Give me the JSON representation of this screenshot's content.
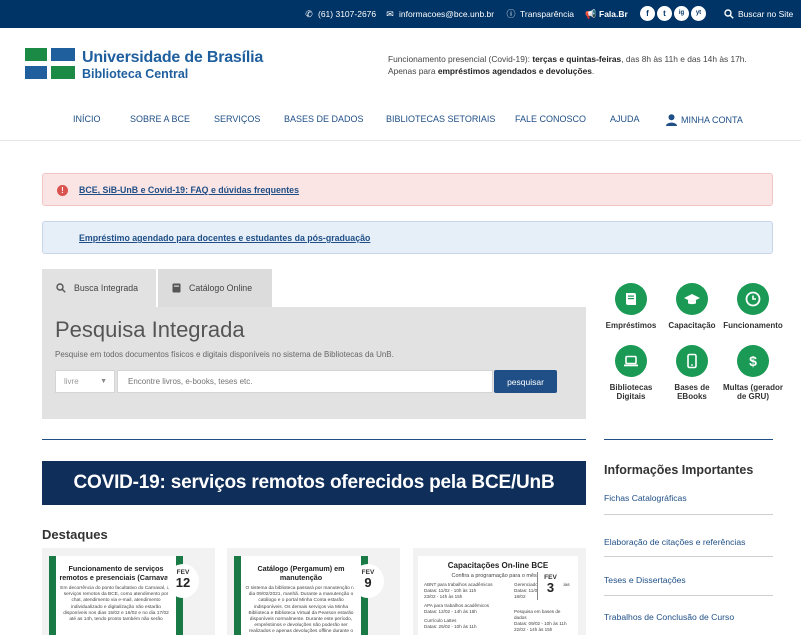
{
  "topbar": {
    "phone": "(61) 3107-2676",
    "email": "informacoes@bce.unb.br",
    "transparency": "Transparência",
    "fala": "Fala.Br",
    "social": [
      "f",
      "t",
      "ig",
      "yt"
    ],
    "search_label": "Buscar no Site"
  },
  "header": {
    "title": "Universidade de Brasília",
    "subtitle": "Biblioteca Central",
    "notice_line1_a": "Funcionamento presencial (Covid-19): ",
    "notice_line1_b": "terças e quintas-feiras",
    "notice_line1_c": ", das 8h às 11h e das 14h às 17h.",
    "notice_line2_a": "Apenas para ",
    "notice_line2_b": "empréstimos agendados e devoluções",
    "notice_line2_c": "."
  },
  "nav": {
    "items": [
      "INÍCIO",
      "SOBRE A BCE",
      "SERVIÇOS",
      "BASES DE DADOS",
      "BIBLIOTECAS SETORIAIS",
      "FALE CONOSCO",
      "AJUDA"
    ],
    "account": "MINHA CONTA"
  },
  "alerts": {
    "covid": "BCE, SiB-UnB e Covid-19: FAQ e dúvidas frequentes",
    "loan": "Empréstimo agendado para docentes e estudantes da pós-graduação"
  },
  "search": {
    "tabs": [
      "Busca Integrada",
      "Catálogo Online"
    ],
    "title": "Pesquisa Integrada",
    "subtitle": "Pesquise em todos documentos físicos e digitais disponíveis no sistema de Bibliotecas da UnB.",
    "select_value": "livre",
    "placeholder": "Encontre livros, e-books, teses etc.",
    "button": "pesquisar"
  },
  "quick_links": [
    {
      "label": "Empréstimos",
      "icon": "book-icon"
    },
    {
      "label": "Capacitação",
      "icon": "graduation-cap-icon"
    },
    {
      "label": "Funcionamento",
      "icon": "clock-icon"
    },
    {
      "label": "Bibliotecas Digitais",
      "icon": "laptop-icon"
    },
    {
      "label": "Bases de EBooks",
      "icon": "tablet-icon"
    },
    {
      "label": "Multas (gerador de GRU)",
      "icon": "dollar-icon"
    }
  ],
  "banner": "COVID-19: serviços remotos oferecidos pela BCE/UnB",
  "destaques": {
    "title": "Destaques",
    "cards": [
      {
        "title": "Funcionamento de serviços remotos e presenciais (Carnaval)",
        "body": "Em decorrência do ponto facultativo do Carnaval, os serviços remotos da BCE, como atendimento por chat, atendimento via e-mail, atendimento individualizado e digitalização não estarão disponíveis nos dias 15/02 e 16/02 e no dia 17/02 até as 14h, tendo pronto também não serão",
        "month": "FEV",
        "day": "12"
      },
      {
        "title": "Catálogo (Pergamum) em manutenção",
        "body": "O sistema da biblioteca passará por manutenção no dia 09/02/2021, manhã. Durante a manutenção o catálogo e o portal Minha Conta estarão indisponíveis. Os demais serviços via Minha Biblioteca e Biblioteca Virtual da Pearson estarão disponíveis normalmente. Durante este período, empréstimos e devoluções não poderão ser realizados e apenas devoluções offline durante o funcionamento.",
        "month": "FEV",
        "day": "9"
      },
      {
        "title": "Capacitações On-line BCE",
        "subtitle": "Confira a programação para o mês de",
        "month": "FEV",
        "day": "3",
        "lines": [
          "ABNT para trabalhos acadêmicos",
          "Datas: 11/02 - 10h às 11h",
          "23/02 - 14h às 15h",
          "APA para trabalhos acadêmicos",
          "Datas: 12/02 - 14h às 15h",
          "Currículo Lattes",
          "Datas: 25/02 - 10h às 11h"
        ],
        "lines_right": [
          "Gerenciador de referências",
          "Datas: 11/02",
          "18/02",
          "Pesquisa em bases de dados",
          "Datas: 09/02 - 10h às 11h",
          "22/02 - 14h às 15h"
        ]
      }
    ]
  },
  "sidebar": {
    "title": "Informações Importantes",
    "links": [
      "Fichas Catalográficas",
      "Elaboração de citações e referências",
      "Teses e Dissertações",
      "Trabalhos de Conclusão de Curso"
    ]
  },
  "colors": {
    "topbar": "#003366",
    "brand_blue": "#1f5f9e",
    "accent_green": "#1a9a55",
    "banner": "#0f2e5a"
  }
}
